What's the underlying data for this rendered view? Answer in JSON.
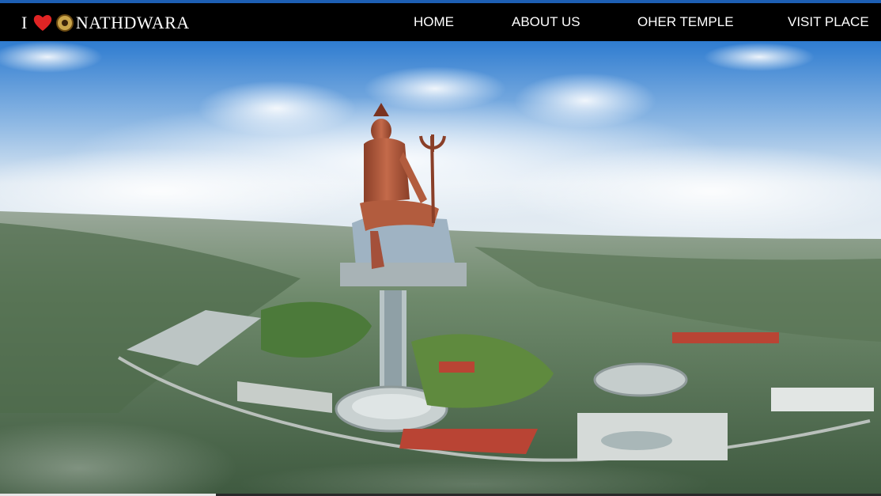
{
  "brand": {
    "prefix": "I",
    "name": "NATHDWARA",
    "heart_icon": "heart-icon",
    "emblem_icon": "temple-emblem-icon"
  },
  "nav": {
    "home": "HOME",
    "about": "ABOUT US",
    "temple": "OHER TEMPLE",
    "visit": "VISIT PLACE"
  },
  "slider": {
    "progress": 0.245
  },
  "colors": {
    "navbar": "#000000",
    "top_stripe": "#1d5fb4",
    "heart": "#e02424"
  }
}
